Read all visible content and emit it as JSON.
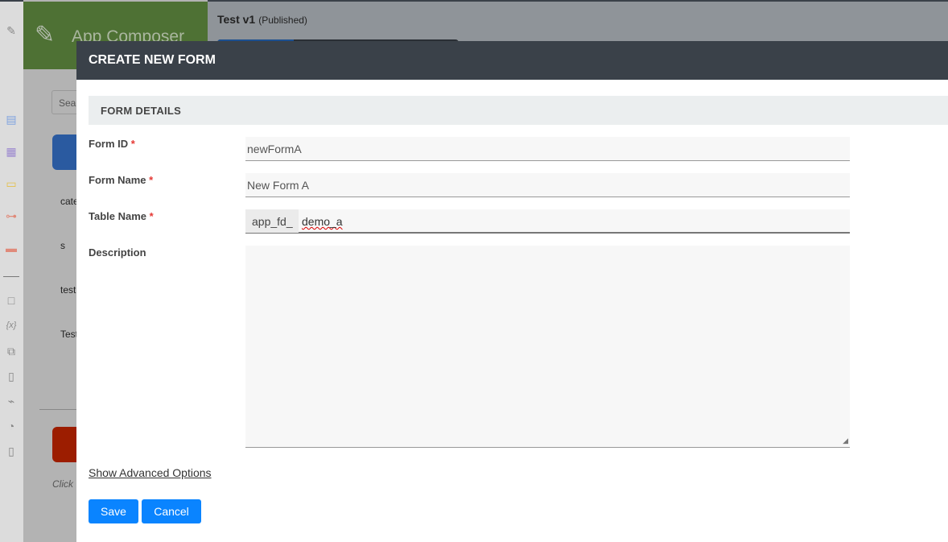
{
  "app": {
    "name": "App Composer"
  },
  "header": {
    "title": "Test v1",
    "status": "(Published)"
  },
  "background": {
    "search_placeholder": "Sear",
    "list": [
      "cate",
      "s",
      "test",
      "Test"
    ],
    "hint": "Click"
  },
  "sidebar_icons": [
    "edit-icon",
    "form-icon",
    "datalist-icon",
    "userview-icon",
    "process-icon",
    "report-icon",
    "note-icon",
    "variable-icon",
    "translate-icon",
    "pdf-icon",
    "plugin-icon",
    "performance-icon",
    "log-icon"
  ],
  "modal": {
    "title": "CREATE NEW FORM",
    "section": "FORM DETAILS",
    "fields": {
      "form_id": {
        "label": "Form ID",
        "required": "*",
        "value": "newFormA"
      },
      "form_name": {
        "label": "Form Name",
        "required": "*",
        "value": "New Form A"
      },
      "table_name": {
        "label": "Table Name",
        "required": "*",
        "prefix": "app_fd_",
        "value": "demo_a"
      },
      "description": {
        "label": "Description",
        "value": ""
      }
    },
    "advanced_link": "Show Advanced Options",
    "save": "Save",
    "cancel": "Cancel"
  }
}
